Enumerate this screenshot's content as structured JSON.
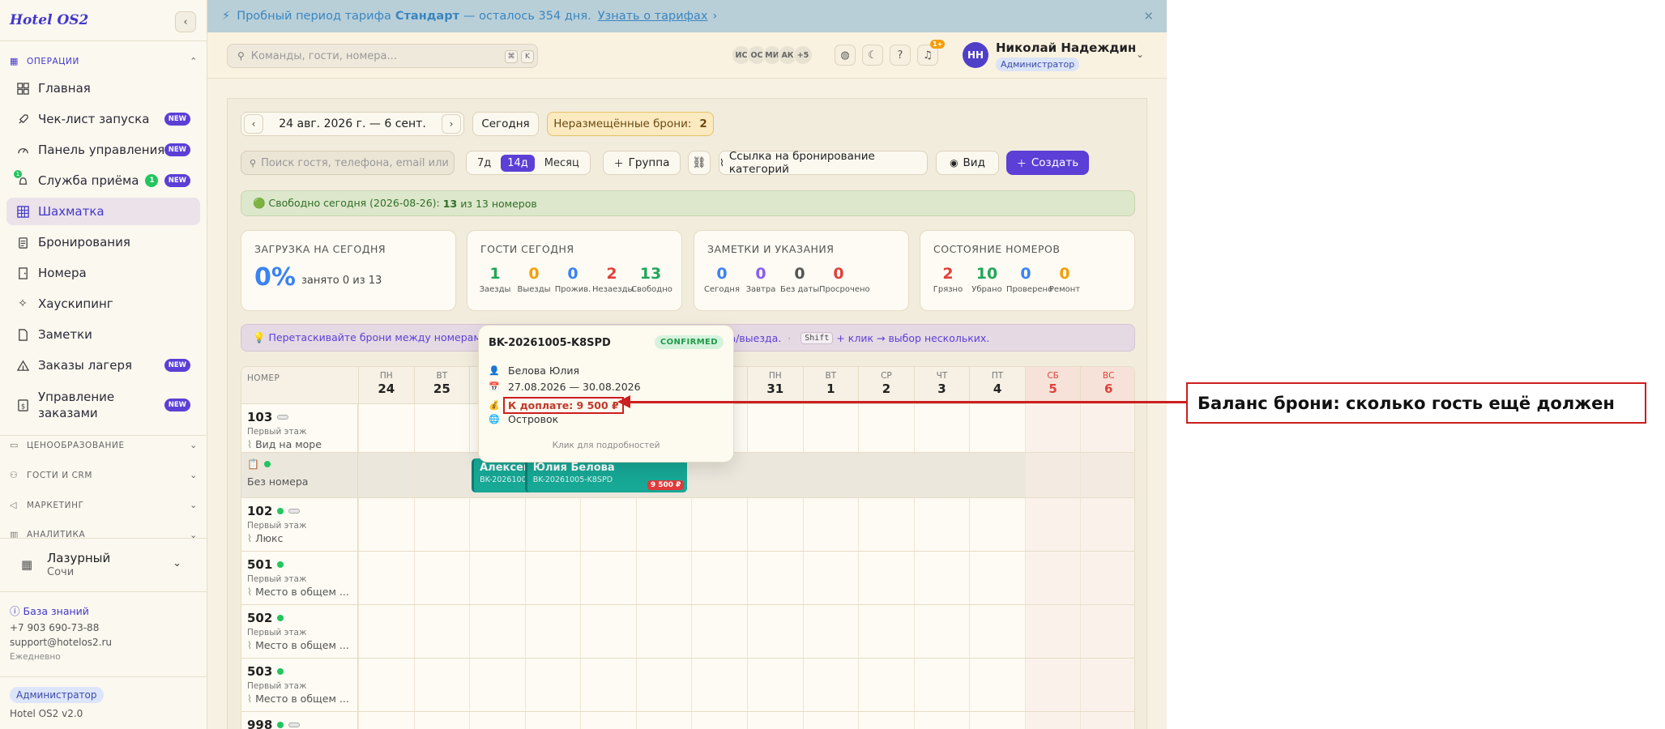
{
  "app": {
    "logo": "Hotel OS2"
  },
  "sidebar": {
    "sections": {
      "ops": "ОПЕРАЦИИ",
      "pricing": "ЦЕНООБРАЗОВАНИЕ",
      "guests": "ГОСТИ И CRM",
      "marketing": "МАРКЕТИНГ",
      "analytics": "АНАЛИТИКА"
    },
    "items": [
      {
        "label": "Главная",
        "icon": "grid-icon"
      },
      {
        "label": "Чек-лист запуска",
        "icon": "rocket-icon",
        "badge": "NEW"
      },
      {
        "label": "Панель управления",
        "icon": "gauge-icon",
        "badge": "NEW"
      },
      {
        "label": "Служба приёма",
        "icon": "bell-icon",
        "count": "1",
        "badge": "NEW",
        "icon_count": "1"
      },
      {
        "label": "Шахматка",
        "icon": "table-icon",
        "active": true
      },
      {
        "label": "Бронирования",
        "icon": "clipboard-icon"
      },
      {
        "label": "Номера",
        "icon": "door-icon"
      },
      {
        "label": "Хаускипинг",
        "icon": "sparkle-icon"
      },
      {
        "label": "Заметки",
        "icon": "note-icon"
      },
      {
        "label": "Заказы лагеря",
        "icon": "tent-icon",
        "badge": "NEW"
      },
      {
        "label": "Управление заказами",
        "icon": "ruble-icon",
        "badge": "NEW"
      }
    ],
    "hotel": {
      "name": "Лазурный",
      "city": "Сочи"
    },
    "knowledge_base": "База знаний",
    "phone": "+7 903 690-73-88",
    "email": "support@hotelos2.ru",
    "hours": "Ежедневно",
    "role": "Администратор",
    "version": "Hotel OS2 v2.0"
  },
  "banner": {
    "prefix": "Пробный период тарифа",
    "plan": "Стандарт",
    "suffix": "— осталось 354 дня.",
    "link": "Узнать о тарифах"
  },
  "header": {
    "search_placeholder": "Команды, гости, номера...",
    "kbd1": "⌘",
    "kbd2": "K",
    "avatars": [
      "ИС",
      "ОС",
      "МИ",
      "АК",
      "+5"
    ],
    "notif_count": "1+",
    "user": {
      "initials": "НН",
      "name": "Николай Надеждин",
      "role": "Администратор"
    }
  },
  "toolbar": {
    "date_range": "24 авг. 2026 г. — 6 сент.",
    "today": "Сегодня",
    "unplaced_label": "Неразмещённые брони:",
    "unplaced_count": "2",
    "guest_search_placeholder": "Поиск гостя, телефона, email или",
    "views": [
      "7д",
      "14д",
      "Месяц"
    ],
    "active_view": "14д",
    "group": "Группа",
    "category_link": "Ссылка на бронирование категорий",
    "view": "Вид",
    "create": "Создать"
  },
  "free_today": {
    "prefix": "🟢 Свободно сегодня (2026-08-26):",
    "free": "13",
    "mid": "из",
    "total": "13 номеров"
  },
  "cards": {
    "load": {
      "title": "ЗАГРУЗКА НА СЕГОДНЯ",
      "value": "0%",
      "sub": "занято 0 из 13"
    },
    "guests": {
      "title": "ГОСТИ СЕГОДНЯ",
      "stats": [
        {
          "n": "1",
          "l": "Заезды",
          "color": "#22a55a"
        },
        {
          "n": "0",
          "l": "Выезды",
          "color": "#f59e0b"
        },
        {
          "n": "0",
          "l": "Прожив.",
          "color": "#3b82f6"
        },
        {
          "n": "2",
          "l": "Незаезды",
          "color": "#e0413a"
        },
        {
          "n": "13",
          "l": "Свободно",
          "color": "#22a55a"
        }
      ]
    },
    "notes": {
      "title": "ЗАМЕТКИ И УКАЗАНИЯ",
      "stats": [
        {
          "n": "0",
          "l": "Сегодня",
          "color": "#3b82f6"
        },
        {
          "n": "0",
          "l": "Завтра",
          "color": "#8b5cf6"
        },
        {
          "n": "0",
          "l": "Без даты",
          "color": "#555555"
        },
        {
          "n": "0",
          "l": "Просрочено",
          "color": "#e0413a"
        }
      ]
    },
    "rooms": {
      "title": "СОСТОЯНИЕ НОМЕРОВ",
      "stats": [
        {
          "n": "2",
          "l": "Грязно",
          "color": "#e0413a"
        },
        {
          "n": "10",
          "l": "Убрано",
          "color": "#22a55a"
        },
        {
          "n": "0",
          "l": "Проверено",
          "color": "#3b82f6"
        },
        {
          "n": "0",
          "l": "Ремонт",
          "color": "#f59e0b"
        }
      ]
    }
  },
  "hint": {
    "text1": "💡 Перетаскивайте брони между номерами",
    "text2": "да/выезда.",
    "sep": "·",
    "key": "Shift",
    "text3": "+ клик → выбор нескольких."
  },
  "grid": {
    "room_header": "НОМЕР",
    "days": [
      {
        "dw": "ПН",
        "dn": "24"
      },
      {
        "dw": "ВТ",
        "dn": "25"
      },
      {
        "dw": "СР",
        "dn": "26"
      },
      {
        "dw": "ЧТ",
        "dn": "27"
      },
      {
        "dw": "ПТ",
        "dn": "28"
      },
      {
        "dw": "СБ",
        "dn": "29",
        "wk": true
      },
      {
        "dw": "ВС",
        "dn": "30",
        "wk": true
      },
      {
        "dw": "ПН",
        "dn": "31"
      },
      {
        "dw": "ВТ",
        "dn": "1"
      },
      {
        "dw": "СР",
        "dn": "2"
      },
      {
        "dw": "ЧТ",
        "dn": "3"
      },
      {
        "dw": "ПТ",
        "dn": "4"
      },
      {
        "dw": "СБ",
        "dn": "5",
        "wk": true
      },
      {
        "dw": "ВС",
        "dn": "6",
        "wk": true
      }
    ],
    "rows": [
      {
        "num": "103",
        "floor": "Первый этаж",
        "cat": "Вид на море",
        "pill": true
      },
      {
        "num": "",
        "floor": "",
        "cat": "Без номера",
        "unassigned": true
      },
      {
        "num": "102",
        "floor": "Первый этаж",
        "cat": "Люкс",
        "dot": true,
        "pill": true
      },
      {
        "num": "501",
        "floor": "Первый этаж",
        "cat": "Место в общем ...",
        "dot": true
      },
      {
        "num": "502",
        "floor": "Первый этаж",
        "cat": "Место в общем ...",
        "dot": true
      },
      {
        "num": "503",
        "floor": "Первый этаж",
        "cat": "Место в общем ...",
        "dot": true
      },
      {
        "num": "998",
        "floor": "",
        "cat": "",
        "dot": true,
        "pill": true
      }
    ],
    "bookings": [
      {
        "name": "Алексей",
        "code": "BK-20261005",
        "color": "#17a896"
      },
      {
        "name": "Юлия Белова",
        "code": "BK-20261005-K8SPD",
        "due": "9 500 ₽",
        "color": "#17a896"
      }
    ]
  },
  "popover": {
    "code": "BK-20261005-K8SPD",
    "status": "CONFIRMED",
    "guest": "Белова Юлия",
    "dates": "27.08.2026 — 30.08.2026",
    "balance": "К доплате: 9 500 ₽",
    "source": "Островок",
    "footer": "Клик для подробностей"
  },
  "annotation": {
    "text": "Баланс брони: сколько гость ещё должен"
  }
}
